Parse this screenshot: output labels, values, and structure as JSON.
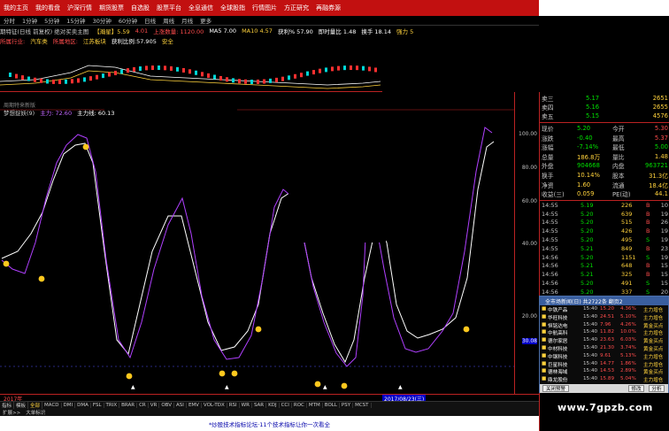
{
  "menu": [
    "我的主页",
    "我的看盘",
    "沪深行情",
    "期货股票",
    "自选股",
    "股票平台",
    "全息通信",
    "全球股指",
    "行情图片",
    "方正研究",
    "再融券源"
  ],
  "toolbar": [
    "分时",
    "1分钟",
    "5分钟",
    "15分钟",
    "30分钟",
    "60分钟",
    "日线",
    "周线",
    "月线",
    "更多"
  ],
  "info1": [
    {
      "t": "期特征(日线 前复权) 绝对买卖主图",
      "c": "#c8c8c8"
    },
    {
      "t": "【瀚星】5.59",
      "c": "#ffd23c"
    },
    {
      "t": "4.01",
      "c": "#ff4c4c"
    },
    {
      "t": "上涨数量: 1120.00",
      "c": "#ff4c4c"
    },
    {
      "t": "MA5 7.00",
      "c": "#ffffff"
    },
    {
      "t": "MA10 4.57",
      "c": "#ffd23c"
    },
    {
      "t": "获利% 57.90",
      "c": "#ffffff"
    },
    {
      "t": "即时量比 1.48",
      "c": "#ffffff"
    },
    {
      "t": "换手 18.14",
      "c": "#ffffff"
    },
    {
      "t": "强力 5",
      "c": "#ffd23c"
    }
  ],
  "info2": [
    {
      "t": "所属行业:",
      "c": "#ff4c4c"
    },
    {
      "t": "汽车类",
      "c": "#ffd23c"
    },
    {
      "t": "所属地区:",
      "c": "#ff4c4c"
    },
    {
      "t": "江苏板块",
      "c": "#ffd23c"
    },
    {
      "t": "获利比例:57.905",
      "c": "#ffffff"
    },
    {
      "t": "安全",
      "c": "#ffd23c"
    }
  ],
  "subinfo": "周期特来新版",
  "indicator": {
    "name": "梦想捉妖(9)",
    "main": "主力: 72.60",
    "line": "主力线: 60.13"
  },
  "axis_ticks": [
    "100.00",
    "80.00",
    "60.00",
    "40.00",
    "20.00",
    "30.08"
  ],
  "dates": {
    "left": "2017年",
    "mid": "2017/08/23(三)"
  },
  "bottom_tabs": [
    "指标",
    "模板",
    "全部",
    "MACD",
    "DMI",
    "DMA",
    "FSL",
    "TRIX",
    "BRAR",
    "CR",
    "VR",
    "OBV",
    "ASI",
    "EMV",
    "VOL-TDX",
    "RSI",
    "WR",
    "SAR",
    "KDJ",
    "CCI",
    "ROC",
    "MTM",
    "BOLL",
    "PSY",
    "MCST"
  ],
  "bottom_bar": [
    "扩展>>",
    "大单标识"
  ],
  "ticker": "*炒股技术指标论坛·11个技术指标让你一次看全",
  "quote": {
    "sell": [
      {
        "l": "卖三",
        "p": "5.17",
        "v": "2651"
      },
      {
        "l": "卖四",
        "p": "5.16",
        "v": "2655"
      },
      {
        "l": "卖五",
        "p": "5.15",
        "v": "4576"
      }
    ],
    "stats": [
      {
        "l": "现价",
        "v": "5.20",
        "l2": "今开",
        "v2": "5.30"
      },
      {
        "l": "涨跌",
        "v": "-0.40",
        "l2": "最高",
        "v2": "5.37"
      },
      {
        "l": "涨幅",
        "v": "-7.14%",
        "l2": "最低",
        "v2": "5.00"
      },
      {
        "l": "总量",
        "v": "186.8万",
        "l2": "量比",
        "v2": "1.48"
      },
      {
        "l": "外盘",
        "v": "904668",
        "l2": "内盘",
        "v2": "963721"
      },
      {
        "l": "换手",
        "v": "10.14%",
        "l2": "股本",
        "v2": "31.3亿"
      },
      {
        "l": "净资",
        "v": "1.60",
        "l2": "流通",
        "v2": "18.4亿"
      },
      {
        "l": "收益(三)",
        "v": "0.059",
        "l2": "PE(动)",
        "v2": "44.1"
      }
    ],
    "trades": [
      {
        "t": "14:55",
        "p": "5.19",
        "v": "226",
        "f": "B",
        "n": "10"
      },
      {
        "t": "14:55",
        "p": "5.20",
        "v": "639",
        "f": "B",
        "n": "19"
      },
      {
        "t": "14:55",
        "p": "5.20",
        "v": "515",
        "f": "B",
        "n": "26"
      },
      {
        "t": "14:55",
        "p": "5.20",
        "v": "426",
        "f": "B",
        "n": "19"
      },
      {
        "t": "14:55",
        "p": "5.20",
        "v": "495",
        "f": "S",
        "n": "19"
      },
      {
        "t": "14:55",
        "p": "5.21",
        "v": "849",
        "f": "B",
        "n": "23"
      },
      {
        "t": "14:56",
        "p": "5.20",
        "v": "1151",
        "f": "S",
        "n": "19"
      },
      {
        "t": "14:56",
        "p": "5.21",
        "v": "648",
        "f": "B",
        "n": "15"
      },
      {
        "t": "14:56",
        "p": "5.21",
        "v": "325",
        "f": "B",
        "n": "15"
      },
      {
        "t": "14:56",
        "p": "5.20",
        "v": "491",
        "f": "S",
        "n": "15"
      },
      {
        "t": "14:56",
        "p": "5.20",
        "v": "337",
        "f": "S",
        "n": "20"
      },
      {
        "t": "14:56",
        "p": "5.20",
        "v": "228",
        "f": "S",
        "n": "17"
      }
    ]
  },
  "popup": {
    "title": "全市场新闻(日) 共2722条 翻页2",
    "rows": [
      {
        "n": "中铁产品",
        "t": "15:40",
        "p": "15.20",
        "c": "4.36%",
        "d": "主力增仓"
      },
      {
        "n": "华旺科技",
        "t": "15:40",
        "p": "24.51",
        "c": "5.10%",
        "d": "主力增仓"
      },
      {
        "n": "恒铭达电",
        "t": "15:40",
        "p": "7.96",
        "c": "4.26%",
        "d": "黄金买点"
      },
      {
        "n": "中航高科",
        "t": "15:40",
        "p": "11.82",
        "c": "10.0%",
        "d": "主力增仓"
      },
      {
        "n": "德尔家居",
        "t": "15:40",
        "p": "23.63",
        "c": "6.03%",
        "d": "黄金买点"
      },
      {
        "n": "中材科技",
        "t": "15:40",
        "p": "21.30",
        "c": "3.74%",
        "d": "黄金买点"
      },
      {
        "n": "中钢科技",
        "t": "15:40",
        "p": "9.61",
        "c": "5.13%",
        "d": "主力增仓"
      },
      {
        "n": "巨星科技",
        "t": "15:40",
        "p": "14.77",
        "c": "1.86%",
        "d": "主力增仓"
      },
      {
        "n": "德林海域",
        "t": "15:40",
        "p": "14.53",
        "c": "2.89%",
        "d": "黄金买点"
      },
      {
        "n": "鼎龙股份",
        "t": "15:40",
        "p": "15.89",
        "c": "5.04%",
        "d": "主力增仓"
      }
    ],
    "btn_close": "关闭预警",
    "btn_edit": "修改",
    "btn_analyze": "分析"
  },
  "watermark": "www.7gpzb.com"
}
